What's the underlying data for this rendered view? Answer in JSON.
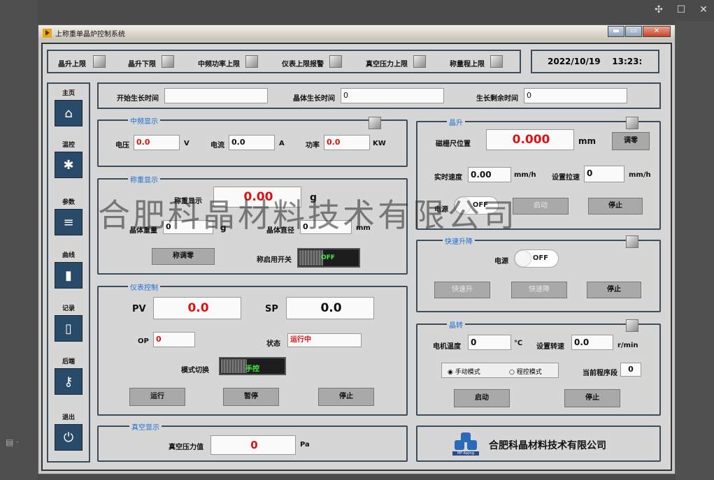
{
  "window": {
    "title": "上称重单晶炉控制系统",
    "min": "▬",
    "max": "▭",
    "close": "✕"
  },
  "alarms": [
    "晶升上限",
    "晶升下限",
    "中频功率上限",
    "仪表上限报警",
    "真空压力上限",
    "称量程上限"
  ],
  "datetime": "2022/10/19    13:23:",
  "nav": [
    {
      "label": "主页",
      "icon": "home-icon",
      "glyph": "⌂"
    },
    {
      "label": "温控",
      "icon": "gear-icon",
      "glyph": "✱"
    },
    {
      "label": "参数",
      "icon": "sliders-icon",
      "glyph": "≡"
    },
    {
      "label": "曲线",
      "icon": "bar-chart-icon",
      "glyph": "▮"
    },
    {
      "label": "记录",
      "icon": "clipboard-icon",
      "glyph": "▯"
    },
    {
      "label": "后端",
      "icon": "key-icon",
      "glyph": "⚷"
    },
    {
      "label": "退出",
      "icon": "power-icon",
      "glyph": "⏻"
    }
  ],
  "times": {
    "start_label": "开始生长时间",
    "start_value": "",
    "crystal_label": "晶体生长时间",
    "crystal_value": "0",
    "remain_label": "生长剩余时间",
    "remain_value": "0"
  },
  "mf": {
    "title": "中频显示",
    "voltage_label": "电压",
    "voltage": "0.0",
    "voltage_unit": "V",
    "current_label": "电流",
    "current": "0.0",
    "current_unit": "A",
    "power_label": "功率",
    "power": "0.0",
    "power_unit": "KW"
  },
  "weigh": {
    "title": "称重显示",
    "display_label": "称重显示",
    "display_value": "0.00",
    "display_unit": "g",
    "crystal_weight_label": "晶体重量",
    "crystal_weight": "0",
    "crystal_weight_unit": "g",
    "diameter_label": "晶体直径",
    "diameter": "0",
    "diameter_unit": "mm",
    "tare_btn": "称调零",
    "enable_label": "称启用开关",
    "enable_state": "OFF"
  },
  "meter": {
    "title": "仪表控制",
    "pv_label": "PV",
    "pv": "0.0",
    "sp_label": "SP",
    "sp": "0.0",
    "op_label": "OP",
    "op": "0",
    "status_label": "状态",
    "status": "运行中",
    "mode_label": "模式切换",
    "mode_state": "手控",
    "run": "运行",
    "pause": "暂停",
    "stop": "停止"
  },
  "vacuum": {
    "title": "真空显示",
    "label": "真空压力值",
    "value": "0",
    "unit": "Pa"
  },
  "lift": {
    "title": "晶升",
    "grating_label": "磁栅尺位置",
    "grating": "0.000",
    "grating_unit": "mm",
    "zero_btn": "调零",
    "speed_label": "实时速度",
    "speed": "0.00",
    "speed_unit": "mm/h",
    "setspeed_label": "设置拉速",
    "setspeed": "0",
    "setspeed_unit": "mm/h",
    "power_label": "电源",
    "power_state": "OFF",
    "start": "启动",
    "stop": "停止"
  },
  "fast": {
    "title": "快速升降",
    "power_label": "电源",
    "power_state": "OFF",
    "up": "快速升",
    "down": "快速降",
    "stop": "停止"
  },
  "rotate": {
    "title": "晶转",
    "temp_label": "电机温度",
    "temp": "0",
    "temp_unit": "℃",
    "setspeed_label": "设置转速",
    "setspeed": "0.0",
    "setspeed_unit": "r/min",
    "manual_mode": "手动模式",
    "program_mode": "程控模式",
    "segment_label": "当前程序段",
    "segment": "0",
    "start": "启动",
    "stop": "停止"
  },
  "company": {
    "name": "合肥科晶材料技术有限公司",
    "logo_text": "MF-Kejing"
  },
  "watermark": "合肥科晶材料技术有限公司"
}
